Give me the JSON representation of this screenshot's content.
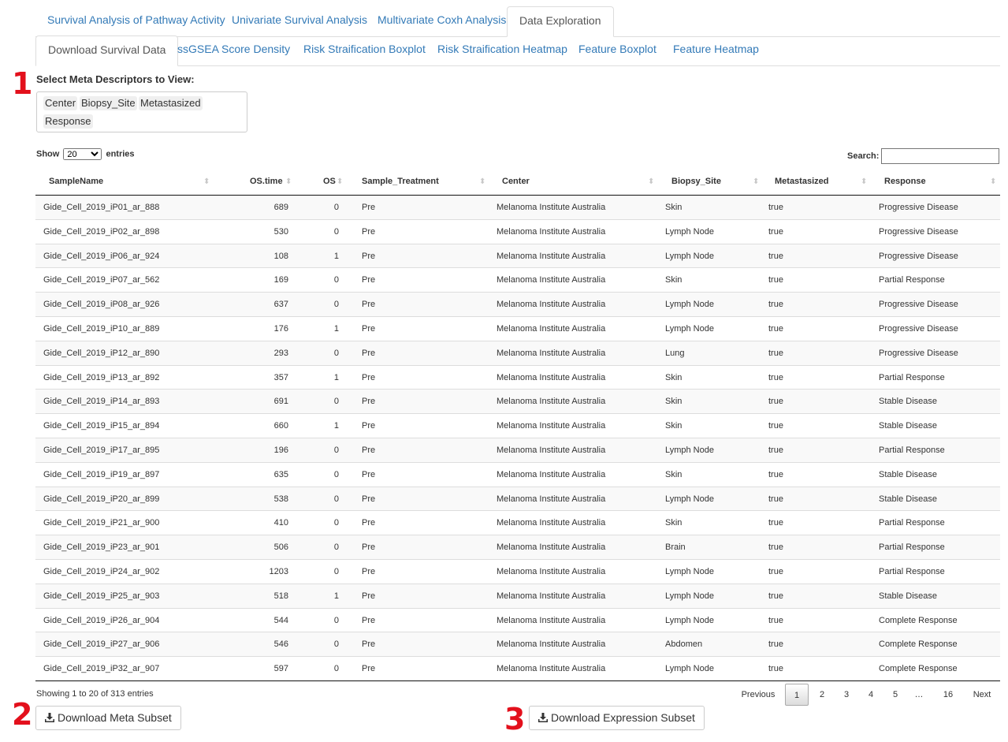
{
  "main_tabs": [
    {
      "label": "Survival Analysis of Pathway Activity",
      "active": false
    },
    {
      "label": "Univariate Survival Analysis",
      "active": false
    },
    {
      "label": "Multivariate Coxh Analysis",
      "active": false
    },
    {
      "label": "Data Exploration",
      "active": true
    }
  ],
  "sub_tabs": [
    {
      "label": "Download Survival Data",
      "active": true
    },
    {
      "label": "ssGSEA Score Density",
      "active": false
    },
    {
      "label": "Risk Straification Boxplot",
      "active": false
    },
    {
      "label": "Risk Straification Heatmap",
      "active": false
    },
    {
      "label": "Feature Boxplot",
      "active": false
    },
    {
      "label": "Feature Heatmap",
      "active": false
    }
  ],
  "annotations": {
    "one": "1",
    "two": "2",
    "three": "3"
  },
  "meta_selector": {
    "label": "Select Meta Descriptors to View:",
    "selected": [
      "Center",
      "Biopsy_Site",
      "Metastasized",
      "Response"
    ]
  },
  "length_control": {
    "prefix": "Show",
    "value": "20",
    "suffix": "entries"
  },
  "search": {
    "label": "Search:",
    "value": ""
  },
  "table": {
    "columns": [
      "SampleName",
      "OS.time",
      "OS",
      "Sample_Treatment",
      "Center",
      "Biopsy_Site",
      "Metastasized",
      "Response"
    ],
    "rows": [
      [
        "Gide_Cell_2019_iP01_ar_888",
        "689",
        "0",
        "Pre",
        "Melanoma Institute Australia",
        "Skin",
        "true",
        "Progressive Disease"
      ],
      [
        "Gide_Cell_2019_iP02_ar_898",
        "530",
        "0",
        "Pre",
        "Melanoma Institute Australia",
        "Lymph Node",
        "true",
        "Progressive Disease"
      ],
      [
        "Gide_Cell_2019_iP06_ar_924",
        "108",
        "1",
        "Pre",
        "Melanoma Institute Australia",
        "Lymph Node",
        "true",
        "Progressive Disease"
      ],
      [
        "Gide_Cell_2019_iP07_ar_562",
        "169",
        "0",
        "Pre",
        "Melanoma Institute Australia",
        "Skin",
        "true",
        "Partial Response"
      ],
      [
        "Gide_Cell_2019_iP08_ar_926",
        "637",
        "0",
        "Pre",
        "Melanoma Institute Australia",
        "Lymph Node",
        "true",
        "Progressive Disease"
      ],
      [
        "Gide_Cell_2019_iP10_ar_889",
        "176",
        "1",
        "Pre",
        "Melanoma Institute Australia",
        "Lymph Node",
        "true",
        "Progressive Disease"
      ],
      [
        "Gide_Cell_2019_iP12_ar_890",
        "293",
        "0",
        "Pre",
        "Melanoma Institute Australia",
        "Lung",
        "true",
        "Progressive Disease"
      ],
      [
        "Gide_Cell_2019_iP13_ar_892",
        "357",
        "1",
        "Pre",
        "Melanoma Institute Australia",
        "Skin",
        "true",
        "Partial Response"
      ],
      [
        "Gide_Cell_2019_iP14_ar_893",
        "691",
        "0",
        "Pre",
        "Melanoma Institute Australia",
        "Skin",
        "true",
        "Stable Disease"
      ],
      [
        "Gide_Cell_2019_iP15_ar_894",
        "660",
        "1",
        "Pre",
        "Melanoma Institute Australia",
        "Skin",
        "true",
        "Stable Disease"
      ],
      [
        "Gide_Cell_2019_iP17_ar_895",
        "196",
        "0",
        "Pre",
        "Melanoma Institute Australia",
        "Lymph Node",
        "true",
        "Partial Response"
      ],
      [
        "Gide_Cell_2019_iP19_ar_897",
        "635",
        "0",
        "Pre",
        "Melanoma Institute Australia",
        "Skin",
        "true",
        "Stable Disease"
      ],
      [
        "Gide_Cell_2019_iP20_ar_899",
        "538",
        "0",
        "Pre",
        "Melanoma Institute Australia",
        "Lymph Node",
        "true",
        "Stable Disease"
      ],
      [
        "Gide_Cell_2019_iP21_ar_900",
        "410",
        "0",
        "Pre",
        "Melanoma Institute Australia",
        "Skin",
        "true",
        "Partial Response"
      ],
      [
        "Gide_Cell_2019_iP23_ar_901",
        "506",
        "0",
        "Pre",
        "Melanoma Institute Australia",
        "Brain",
        "true",
        "Partial Response"
      ],
      [
        "Gide_Cell_2019_iP24_ar_902",
        "1203",
        "0",
        "Pre",
        "Melanoma Institute Australia",
        "Lymph Node",
        "true",
        "Partial Response"
      ],
      [
        "Gide_Cell_2019_iP25_ar_903",
        "518",
        "1",
        "Pre",
        "Melanoma Institute Australia",
        "Lymph Node",
        "true",
        "Stable Disease"
      ],
      [
        "Gide_Cell_2019_iP26_ar_904",
        "544",
        "0",
        "Pre",
        "Melanoma Institute Australia",
        "Lymph Node",
        "true",
        "Complete Response"
      ],
      [
        "Gide_Cell_2019_iP27_ar_906",
        "546",
        "0",
        "Pre",
        "Melanoma Institute Australia",
        "Abdomen",
        "true",
        "Complete Response"
      ],
      [
        "Gide_Cell_2019_iP32_ar_907",
        "597",
        "0",
        "Pre",
        "Melanoma Institute Australia",
        "Lymph Node",
        "true",
        "Complete Response"
      ]
    ]
  },
  "table_info": "Showing 1 to 20 of 313 entries",
  "pagination": {
    "previous": "Previous",
    "pages": [
      "1",
      "2",
      "3",
      "4",
      "5",
      "…",
      "16"
    ],
    "current": "1",
    "next": "Next"
  },
  "buttons": {
    "download_meta": "Download Meta Subset",
    "download_expression": "Download Expression Subset"
  },
  "icons": {
    "download": "download-icon",
    "sort": "sort-both-icon"
  },
  "colors": {
    "annotation": "#e3101c",
    "link": "#337ab7"
  }
}
